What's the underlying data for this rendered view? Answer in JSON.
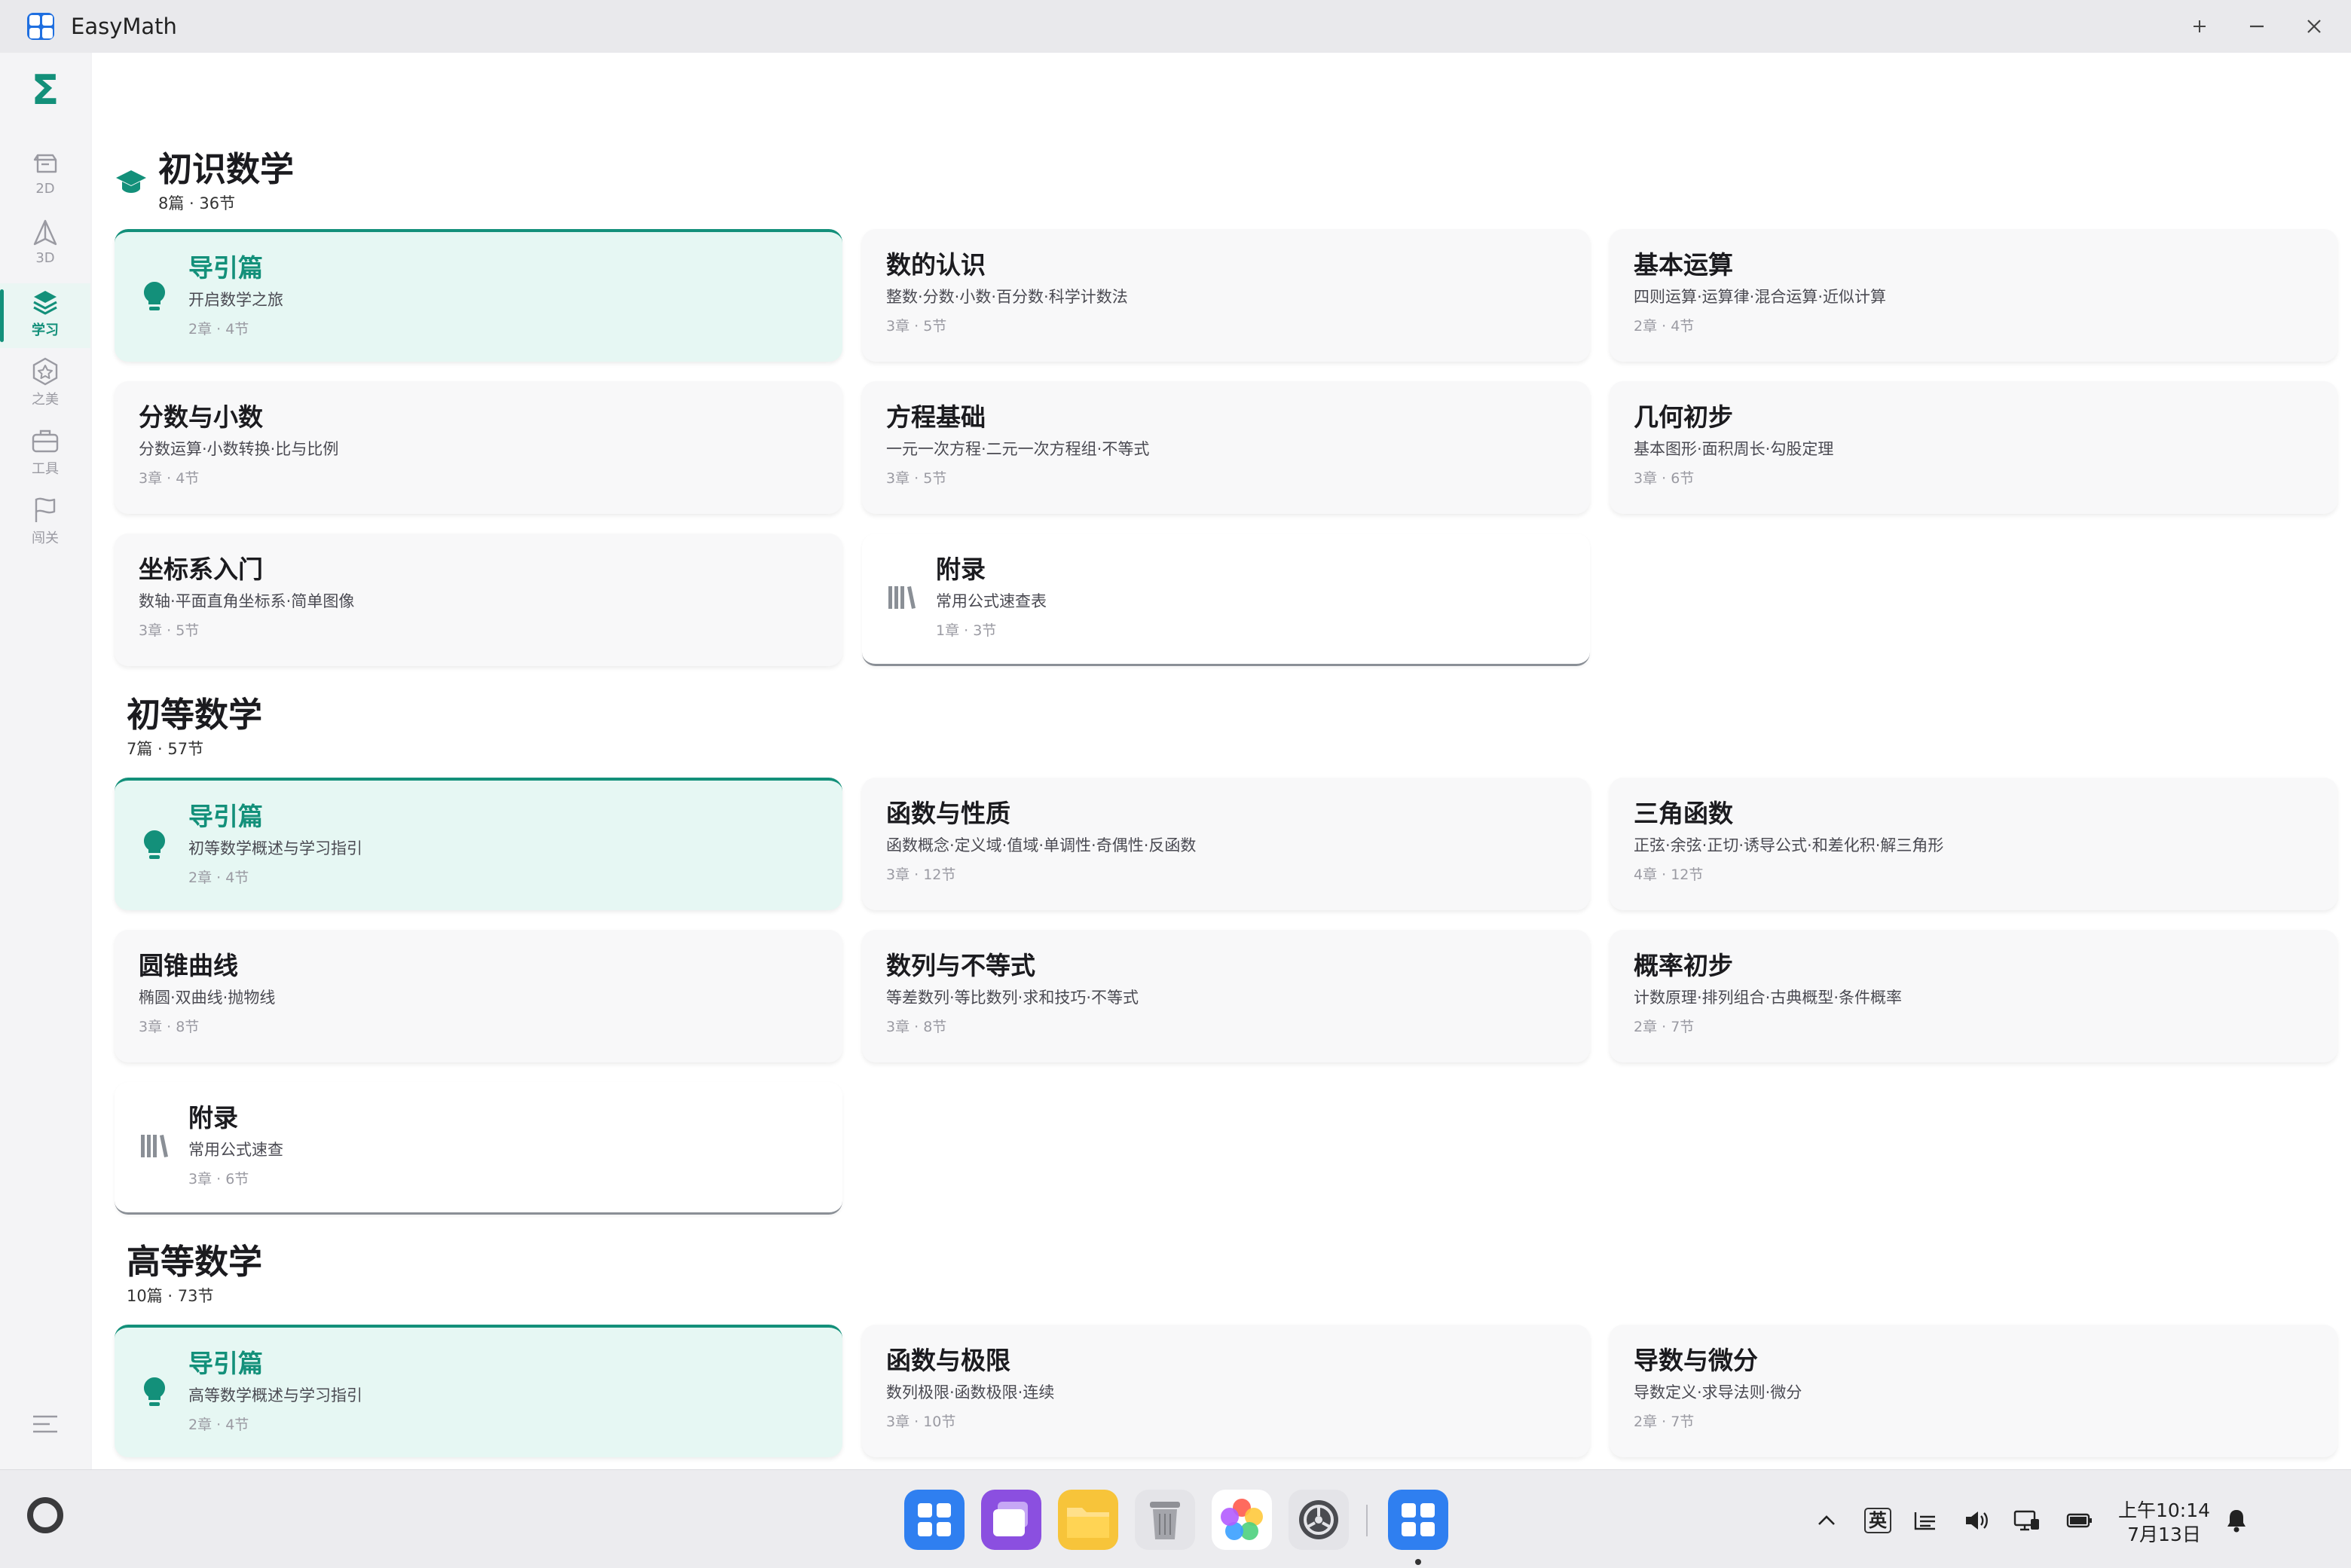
{
  "window": {
    "title": "EasyMath"
  },
  "sidebar": {
    "items": [
      {
        "label": "2D",
        "icon": "2d-shape-icon",
        "active": false
      },
      {
        "label": "3D",
        "icon": "3d-shape-icon",
        "active": false
      },
      {
        "label": "学习",
        "icon": "layers-stack-icon",
        "active": true
      },
      {
        "label": "之美",
        "icon": "hexagon-badge-icon",
        "active": false
      },
      {
        "label": "工具",
        "icon": "toolbox-icon",
        "active": false
      },
      {
        "label": "闯关",
        "icon": "flag-icon",
        "active": false
      }
    ]
  },
  "sections": [
    {
      "title": "初识数学",
      "subtitle": "8篇 · 36节",
      "cards": [
        {
          "title": "导引篇",
          "desc": "开启数学之旅",
          "meta": "2章 · 4节",
          "kind": "intro"
        },
        {
          "title": "数的认识",
          "desc": "整数·分数·小数·百分数·科学计数法",
          "meta": "3章 · 5节",
          "kind": "normal"
        },
        {
          "title": "基本运算",
          "desc": "四则运算·运算律·混合运算·近似计算",
          "meta": "2章 · 4节",
          "kind": "normal"
        },
        {
          "title": "分数与小数",
          "desc": "分数运算·小数转换·比与比例",
          "meta": "3章 · 4节",
          "kind": "normal"
        },
        {
          "title": "方程基础",
          "desc": "一元一次方程·二元一次方程组·不等式",
          "meta": "3章 · 5节",
          "kind": "normal"
        },
        {
          "title": "几何初步",
          "desc": "基本图形·面积周长·勾股定理",
          "meta": "3章 · 6节",
          "kind": "normal"
        },
        {
          "title": "坐标系入门",
          "desc": "数轴·平面直角坐标系·简单图像",
          "meta": "3章 · 5节",
          "kind": "normal"
        },
        {
          "title": "附录",
          "desc": "常用公式速查表",
          "meta": "1章 · 3节",
          "kind": "appendix"
        }
      ]
    },
    {
      "title": "初等数学",
      "subtitle": "7篇 · 57节",
      "cards": [
        {
          "title": "导引篇",
          "desc": "初等数学概述与学习指引",
          "meta": "2章 · 4节",
          "kind": "intro"
        },
        {
          "title": "函数与性质",
          "desc": "函数概念·定义域·值域·单调性·奇偶性·反函数",
          "meta": "3章 · 12节",
          "kind": "normal"
        },
        {
          "title": "三角函数",
          "desc": "正弦·余弦·正切·诱导公式·和差化积·解三角形",
          "meta": "4章 · 12节",
          "kind": "normal"
        },
        {
          "title": "圆锥曲线",
          "desc": "椭圆·双曲线·抛物线",
          "meta": "3章 · 8节",
          "kind": "normal"
        },
        {
          "title": "数列与不等式",
          "desc": "等差数列·等比数列·求和技巧·不等式",
          "meta": "3章 · 8节",
          "kind": "normal"
        },
        {
          "title": "概率初步",
          "desc": "计数原理·排列组合·古典概型·条件概率",
          "meta": "2章 · 7节",
          "kind": "normal"
        },
        {
          "title": "附录",
          "desc": "常用公式速查",
          "meta": "3章 · 6节",
          "kind": "appendix"
        }
      ]
    },
    {
      "title": "高等数学",
      "subtitle": "10篇 · 73节",
      "cards": [
        {
          "title": "导引篇",
          "desc": "高等数学概述与学习指引",
          "meta": "2章 · 4节",
          "kind": "intro"
        },
        {
          "title": "函数与极限",
          "desc": "数列极限·函数极限·连续",
          "meta": "3章 · 10节",
          "kind": "normal"
        },
        {
          "title": "导数与微分",
          "desc": "导数定义·求导法则·微分",
          "meta": "2章 · 7节",
          "kind": "normal"
        }
      ]
    }
  ],
  "taskbar": {
    "ime": "英",
    "clock_time": "上午10:14",
    "clock_date": "7月13日"
  },
  "colors": {
    "accent": "#13907a",
    "intro_bg": "#e6f7f3",
    "appendix_border": "#8a8f96"
  }
}
